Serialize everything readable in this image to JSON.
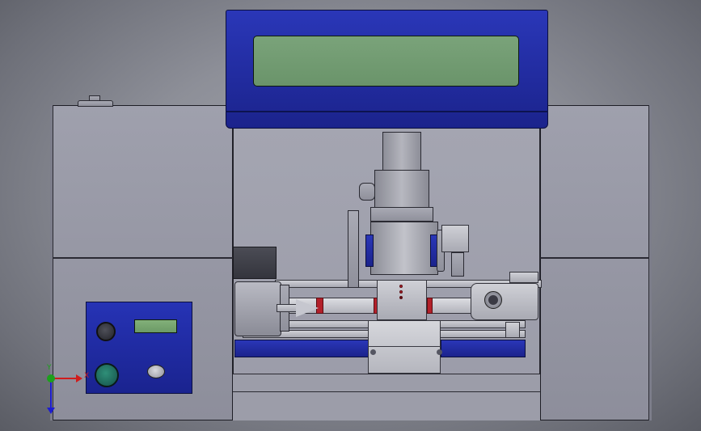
{
  "viewport": {
    "title": "",
    "background_color": "#8d8f98"
  },
  "machine": {
    "name": "",
    "colors": {
      "enclosure": "#9495a3",
      "display_housing": "#1e2aa6",
      "lcd_screen": "#6f9a6f",
      "control_panel": "#1f2ba8",
      "rail": "#2432b0",
      "accent_red": "#b3202a"
    },
    "main_display": {
      "text": ""
    },
    "control_panel": {
      "lcd_text": "",
      "button_top": "",
      "button_bottom": "",
      "knob": ""
    }
  },
  "triad": {
    "x_axis_label": "X",
    "y_axis_label": "Y",
    "z_axis_label": "",
    "colors": {
      "x": "#d01c1c",
      "y": "#1ca01c",
      "z": "#1c1cd0"
    }
  }
}
